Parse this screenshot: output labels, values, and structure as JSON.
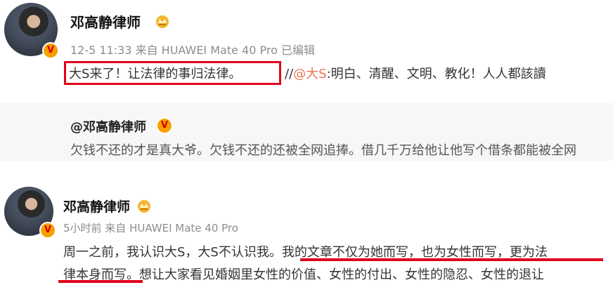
{
  "post1": {
    "author": "邓高静律师",
    "meta": "12-5 11:33 来自 HUAWEI Mate 40 Pro 已编辑",
    "highlight_text": "大S来了！让法律的事归法律。",
    "sep": "//",
    "mention": "@大S",
    "rest_text": ":明白、清醒、文明、教化！人人都該讀"
  },
  "repost": {
    "author": "@邓高静律师",
    "text": "欠钱不还的才是真大爷。欠钱不还的还被全网追捧。借几千万给他让他写个借条都能被全网"
  },
  "post2": {
    "author": "邓高静律师",
    "meta": "5小时前 来自 HUAWEI Mate 40 Pro",
    "line1_plain": "周一之前，我认识大S，大S不认识我。",
    "line1_underlined": "我的文章不仅为她而写，也为女性而写，更为法",
    "line2_underlined": "律本身而写。",
    "line2_plain": "想让大家看见婚姻里女性的价值、女性的付出、女性的隐忍、女性的退让"
  },
  "badges": {
    "verified": "V"
  },
  "colors": {
    "accent_red": "#e0001b",
    "link_orange": "#eb7350",
    "verified_gold": "#f7a000"
  }
}
